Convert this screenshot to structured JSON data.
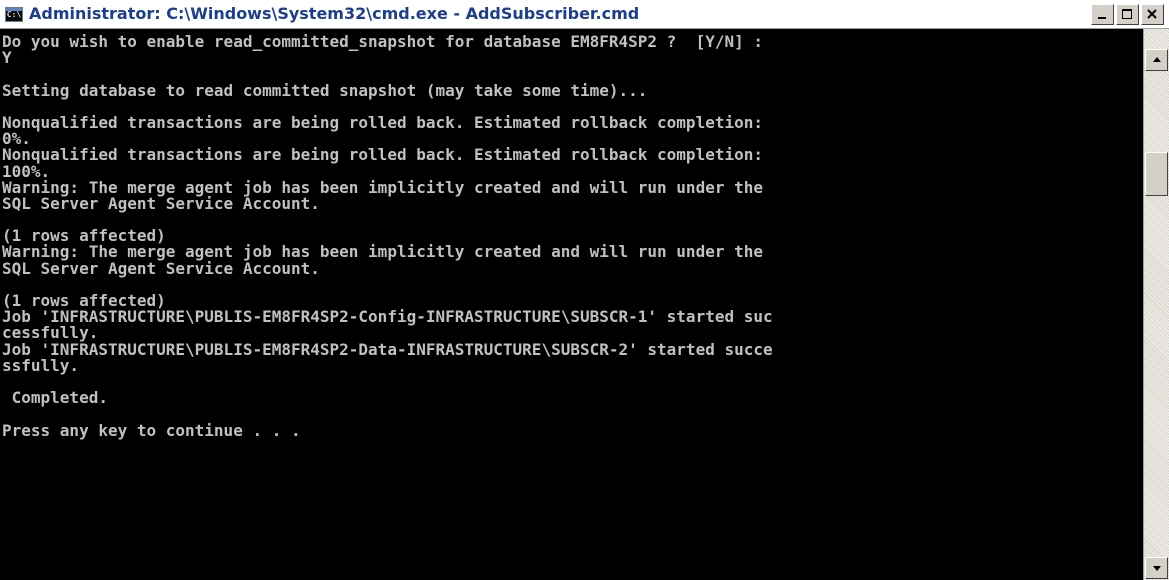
{
  "window": {
    "title": "Administrator: C:\\Windows\\System32\\cmd.exe - AddSubscriber.cmd",
    "icon_text": "C:\\",
    "icon_name": "cmd-icon"
  },
  "console": {
    "lines": [
      "Do you wish to enable read_committed_snapshot for database EM8FR4SP2 ?  [Y/N] :",
      "Y",
      "",
      "Setting database to read committed snapshot (may take some time)...",
      "",
      "Nonqualified transactions are being rolled back. Estimated rollback completion:",
      "0%.",
      "Nonqualified transactions are being rolled back. Estimated rollback completion:",
      "100%.",
      "Warning: The merge agent job has been implicitly created and will run under the",
      "SQL Server Agent Service Account.",
      "",
      "(1 rows affected)",
      "Warning: The merge agent job has been implicitly created and will run under the",
      "SQL Server Agent Service Account.",
      "",
      "(1 rows affected)",
      "Job 'INFRASTRUCTURE\\PUBLIS-EM8FR4SP2-Config-INFRASTRUCTURE\\SUBSCR-1' started suc",
      "cessfully.",
      "Job 'INFRASTRUCTURE\\PUBLIS-EM8FR4SP2-Data-INFRASTRUCTURE\\SUBSCR-2' started succe",
      "ssfully.",
      "",
      " Completed.",
      "",
      "Press any key to continue . . ."
    ]
  },
  "colors": {
    "background": "#000000",
    "text": "#c0c0c0",
    "title_text": "#1d3e8f"
  }
}
